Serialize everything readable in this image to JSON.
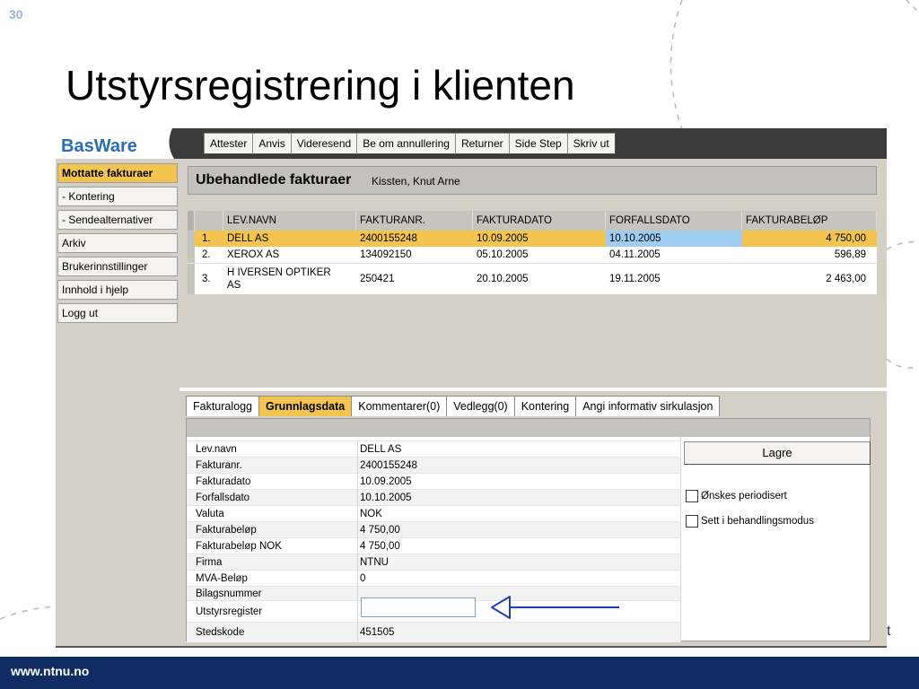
{
  "slide": {
    "number": "30",
    "title": "Utstyrsregistrering i klienten",
    "footer_url": "www.ntnu.no",
    "stray_text": "t"
  },
  "app": {
    "logo": "BasWare",
    "toolbar": [
      "Attester",
      "Anvis",
      "Videresend",
      "Be om annullering",
      "Returner",
      "Side Step",
      "Skriv ut"
    ],
    "nav": [
      "Mottatte fakturaer",
      "- Kontering",
      "- Sendealternativer",
      "Arkiv",
      "Brukerinnstillinger",
      "Innhold i hjelp",
      "Logg ut"
    ],
    "header": {
      "title": "Ubehandlede fakturaer",
      "user": "Kissten, Knut Arne"
    },
    "grid": {
      "columns": [
        "",
        "LEV.NAVN",
        "FAKTURANR.",
        "FAKTURADATO",
        "FORFALLSDATO",
        "FAKTURABELØP"
      ],
      "rows": [
        {
          "no": "1.",
          "name": "DELL AS",
          "invoice": "2400155248",
          "date": "10.09.2005",
          "due": "10.10.2005",
          "amount": "4 750,00"
        },
        {
          "no": "2.",
          "name": "XEROX AS",
          "invoice": "134092150",
          "date": "05.10.2005",
          "due": "04.11.2005",
          "amount": "596,89"
        },
        {
          "no": "3.",
          "name": "H IVERSEN OPTIKER AS",
          "invoice": "250421",
          "date": "20.10.2005",
          "due": "19.11.2005",
          "amount": "2 463,00"
        }
      ]
    },
    "tabs": [
      "Fakturalogg",
      "Grunnlagsdata",
      "Kommentarer(0)",
      "Vedlegg(0)",
      "Kontering",
      "Angi informativ sirkulasjon"
    ],
    "details": [
      {
        "label": "Lev.navn",
        "value": "DELL AS"
      },
      {
        "label": "Fakturanr.",
        "value": "2400155248"
      },
      {
        "label": "Fakturadato",
        "value": "10.09.2005"
      },
      {
        "label": "Forfallsdato",
        "value": "10.10.2005"
      },
      {
        "label": "Valuta",
        "value": "NOK"
      },
      {
        "label": "Fakturabeløp",
        "value": "4 750,00"
      },
      {
        "label": "Fakturabeløp NOK",
        "value": "4 750,00"
      },
      {
        "label": "Firma",
        "value": "NTNU"
      },
      {
        "label": "MVA-Beløp",
        "value": "0"
      },
      {
        "label": "Bilagsnummer",
        "value": ""
      },
      {
        "label": "Utstyrsregister",
        "value": ""
      },
      {
        "label": "Stedskode",
        "value": "451505"
      }
    ],
    "save_label": "Lagre",
    "checkboxes": [
      "Ønskes periodisert",
      "Sett i behandlingsmodus"
    ]
  },
  "colors": {
    "accent": "#f3c54e",
    "footer": "#0f2d63",
    "arrow": "#1f3fbf",
    "logo": "#2a6db5"
  },
  "icons": {
    "arrow": "left-arrow-icon"
  }
}
